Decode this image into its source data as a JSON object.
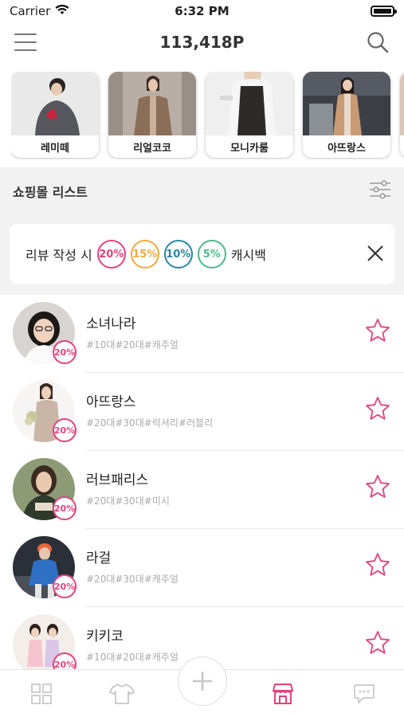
{
  "status_bar": {
    "carrier": "Carrier",
    "time": "6:32 PM"
  },
  "header": {
    "points": "113,418P"
  },
  "malls": [
    {
      "name": "레미떼"
    },
    {
      "name": "리얼코코"
    },
    {
      "name": "모니카룸"
    },
    {
      "name": "아뜨랑스"
    }
  ],
  "section": {
    "title": "쇼핑몰 리스트"
  },
  "banner": {
    "prefix": "리뷰 작성 시",
    "suffix": "캐시백",
    "rates": [
      {
        "label": "20%",
        "color": "#e4427c"
      },
      {
        "label": "15%",
        "color": "#f3a93a"
      },
      {
        "label": "10%",
        "color": "#2b86a3"
      },
      {
        "label": "5%",
        "color": "#4fb98a"
      }
    ]
  },
  "shops": [
    {
      "name": "소녀나라",
      "tags": "#10대#20대#캐주얼",
      "rate": "20%"
    },
    {
      "name": "아뜨랑스",
      "tags": "#20대#30대#럭셔리#러블리",
      "rate": "20%"
    },
    {
      "name": "러브패리스",
      "tags": "#20대#30대#미시",
      "rate": "20%"
    },
    {
      "name": "라걸",
      "tags": "#20대#30대#캐주얼",
      "rate": "20%"
    },
    {
      "name": "키키코",
      "tags": "#10대#20대#캐주얼",
      "rate": "20%"
    }
  ],
  "colors": {
    "accent": "#e4427c",
    "tab_inactive": "#c8c8c8"
  },
  "tabbar": {
    "icons": [
      "grid-icon",
      "tshirt-icon",
      "plus-icon",
      "store-icon",
      "chat-icon"
    ],
    "active": "store-icon"
  }
}
